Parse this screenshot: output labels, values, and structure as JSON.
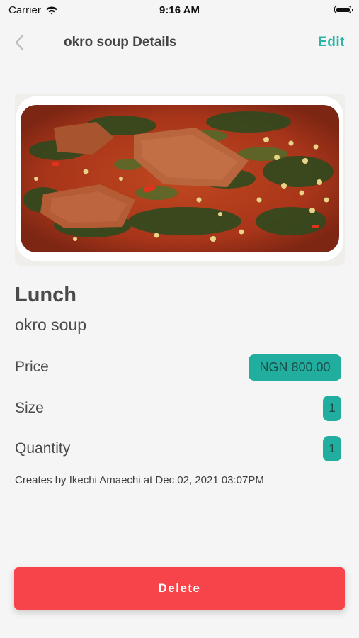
{
  "status_bar": {
    "carrier": "Carrier",
    "time": "9:16 AM",
    "icons": [
      "wifi-icon",
      "battery-icon"
    ]
  },
  "nav": {
    "back_icon": "chevron-left-icon",
    "title": "okro soup Details",
    "edit_label": "Edit"
  },
  "meal": {
    "image_subject": "okro soup",
    "type": "Lunch",
    "name": "okro soup"
  },
  "details": {
    "price_label": "Price",
    "price_value": "NGN 800.00",
    "size_label": "Size",
    "size_value": "1",
    "quantity_label": "Quantity",
    "quantity_value": "1"
  },
  "created_by": "Creates by Ikechi Amaechi at Dec 02, 2021 03:07PM",
  "delete_label": "Delete",
  "colors": {
    "accent": "#22ae9f",
    "edit": "#2bb6a8",
    "danger": "#f6444a",
    "background": "#f5f5f5"
  }
}
